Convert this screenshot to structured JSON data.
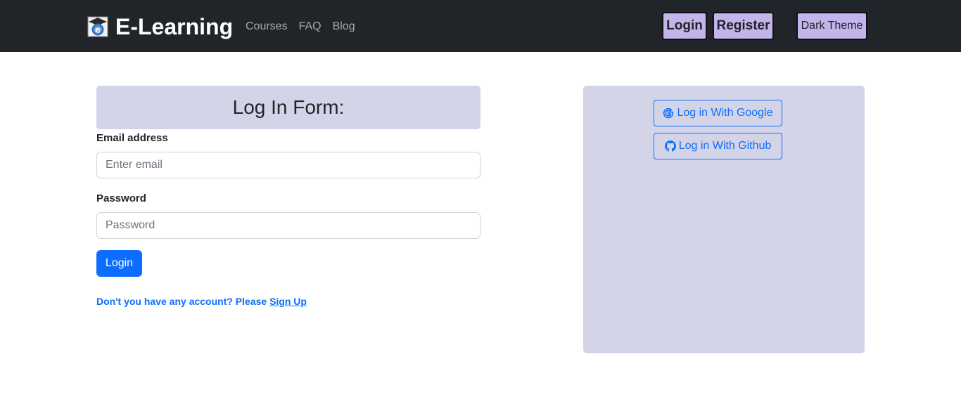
{
  "navbar": {
    "brand": "E-Learning",
    "links": [
      "Courses",
      "FAQ",
      "Blog"
    ],
    "login_label": "Login",
    "register_label": "Register",
    "theme_label": "Dark Theme"
  },
  "form": {
    "title": "Log In Form:",
    "email_label": "Email address",
    "email_placeholder": "Enter email",
    "password_label": "Password",
    "password_placeholder": "Password",
    "submit_label": "Login",
    "signup_prompt": "Don't you have any account? Please ",
    "signup_link": "Sign Up"
  },
  "social": {
    "google_label": "Log in With Google",
    "github_label": "Log in With Github"
  },
  "icons": {
    "brand": "graduation-cap-e-logo-icon",
    "google": "google-icon",
    "github": "github-icon"
  },
  "colors": {
    "navbar_bg": "#212529",
    "accent_button": "#c3b5ec",
    "panel_bg": "#d4d4e8",
    "primary": "#0d6efd"
  }
}
